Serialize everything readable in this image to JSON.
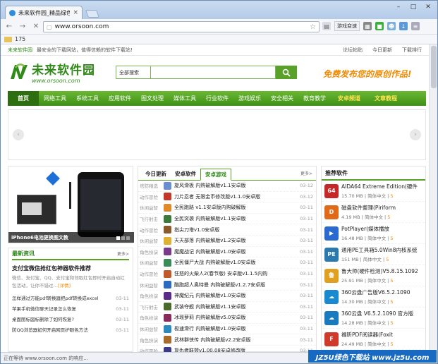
{
  "browser": {
    "tab_title": "未来软件园_精品绿色软件",
    "url": "www.orsoon.com",
    "bookmark_count": "175",
    "toolbar_translate": "游戏变速",
    "status": "正在等待 www.orsoon.com 的响应..."
  },
  "site": {
    "topbar": {
      "brand": "未来软件园",
      "tagline": "最安全的下载网站，值得信赖的软件下载站!",
      "links": [
        "论坛帖贴",
        "今日更新",
        "下载排行"
      ]
    },
    "logo_cn": "未来软件园",
    "logo_en": "www.orsoon.com",
    "search_select": "全部搜索",
    "slogan": "免费发布您的原创作品!",
    "nav": [
      "首页",
      "网络工具",
      "系统工具",
      "应用软件",
      "图文处理",
      "媒体工具",
      "行业软件",
      "游戏娱乐",
      "安全相关",
      "教育教学",
      "安卓频道",
      "文章教程"
    ],
    "banner_prev": "‹",
    "banner_next": "›"
  },
  "left": {
    "photo_caption": "iPhone6电池更换图文教",
    "news_title": "最新资讯",
    "news_more": "更多>",
    "headline": "支付宝微信抢红包神器软件推荐",
    "summary": "微信、支付宝、QQ、支付宝和领取红包即时开启自动红包活动，让你不错过…",
    "summary_link": "[详情]",
    "items": [
      {
        "t": "怎样通过万能pdf转换器把pdf转换成excel",
        "d": "03-11"
      },
      {
        "t": "苹果手机微信聊天记录怎么恢复",
        "d": "03-11"
      },
      {
        "t": "桌面图标図标删除了如何恢复?",
        "d": "03-11"
      },
      {
        "t": "防QQ浏览器如何开启网页护眼色方法",
        "d": "03-11"
      }
    ]
  },
  "center": {
    "tabs": [
      "今日更新",
      "安卓软件",
      "安卓游戏"
    ],
    "more": "更多>",
    "rows": [
      {
        "c": "塔防精选",
        "n": "旋风滑板 内购破解版v1.1安卓版",
        "d": "03-12",
        "col": "#6a8fd0"
      },
      {
        "c": "动作冒险",
        "n": "刀片忍者 无限金币修改版v1.1.0安卓版",
        "d": "03-12",
        "col": "#c0392b"
      },
      {
        "c": "休闲益智",
        "n": "全民跑路 v1.1安卓版内购破解版",
        "d": "03-11",
        "col": "#e08a2a"
      },
      {
        "c": "飞行射击",
        "n": "全民突袭 内购破解版v1.1安卓版",
        "d": "03-11",
        "col": "#3b7a3a"
      },
      {
        "c": "动作冒险",
        "n": "指尖刀塔v1.0安卓版",
        "d": "03-11",
        "col": "#8a5a2a"
      },
      {
        "c": "休闲益智",
        "n": "天天部落 内购破解版v1.2安卓版",
        "d": "03-11",
        "col": "#e0b030"
      },
      {
        "c": "角色扮演",
        "n": "魔魔战记 内购破解版v1.0安卓版",
        "d": "03-11",
        "col": "#7a3a8a"
      },
      {
        "c": "休闲益智",
        "n": "全民僵尸大战 内购破解版v1.0安卓版",
        "d": "03-11",
        "col": "#3a8a5a"
      },
      {
        "c": "动作冒险",
        "n": "狂怒的火柴人2(春节版) 安卓版v1.1.5内购",
        "d": "03-11",
        "col": "#c05a2a"
      },
      {
        "c": "休闲益智",
        "n": "酷跑超人奥特曼 内购破解版v1.2.7安卓版",
        "d": "03-11",
        "col": "#2a6ac0"
      },
      {
        "c": "角色扮演",
        "n": "神魔纪元 内购破解版v1.0安卓版",
        "d": "03-11",
        "col": "#5a2a8a"
      },
      {
        "c": "飞行射击",
        "n": "武装夺舰 内购破解版v1.1安卓版",
        "d": "03-11",
        "col": "#4a6a2a"
      },
      {
        "c": "角色扮演",
        "n": "冰瑶萝莉 内购破解版v5.0安卓版",
        "d": "03-11",
        "col": "#8a2a5a"
      },
      {
        "c": "休闲益智",
        "n": "极速滑行 内购破解版v1.0安卓版",
        "d": "03-11",
        "col": "#2a8ac0"
      },
      {
        "c": "角色扮演",
        "n": "武林群侠传 内购破解版v2.2安卓版",
        "d": "03-11",
        "col": "#aa6a2a"
      },
      {
        "c": "动作冒险",
        "n": "复仇者联盟v1.00.08安卓修改版",
        "d": "03-11",
        "col": "#3a3a8a"
      },
      {
        "c": "塔防精选",
        "n": "森霸战机(战神版) v1.00.02安卓内购破解",
        "d": "03-11",
        "col": "#8a8a2a"
      }
    ]
  },
  "right": {
    "title": "推荐软件",
    "items": [
      {
        "n": "AIDA64 Extreme Edition(硬件",
        "s": "15.70 MB",
        "l": "简体中文",
        "r": "5",
        "col": "#c62828",
        "g": "64"
      },
      {
        "n": "磁盘软件整理(Piriform",
        "s": "4.19 MB",
        "l": "简体中文",
        "r": "5",
        "col": "#e06a1a",
        "g": "D"
      },
      {
        "n": "PotPlayer(媒体播放",
        "s": "16.48 MB",
        "l": "简体中文",
        "r": "5",
        "col": "#2a6ad0",
        "g": "▶"
      },
      {
        "n": "通用PE工具箱5.0Win8内核系统",
        "s": "151 MB",
        "l": "简体中文",
        "r": "5",
        "col": "#2a7ab0",
        "g": "PE"
      },
      {
        "n": "鲁大师(硬件检测)V5.8.15.1092",
        "s": "25.91 MB",
        "l": "简体中文",
        "r": "5",
        "col": "#e0a020",
        "g": "鲁"
      },
      {
        "n": "360云盘广告版V6.5.2.1090",
        "s": "14.30 MB",
        "l": "简体中文",
        "r": "5",
        "col": "#1a8ad0",
        "g": "☁"
      },
      {
        "n": "360云盘 V6.5.2.1090 官方版",
        "s": "14.28 MB",
        "l": "简体中文",
        "r": "5",
        "col": "#1a7ac0",
        "g": "☁"
      },
      {
        "n": "福昕PDF阅读器(Foxit",
        "s": "24.49 MB",
        "l": "简体中文",
        "r": "5",
        "col": "#d03a2a",
        "g": "F"
      }
    ]
  },
  "watermark": "JZ5U绿色下载站 www.jz5u.com"
}
